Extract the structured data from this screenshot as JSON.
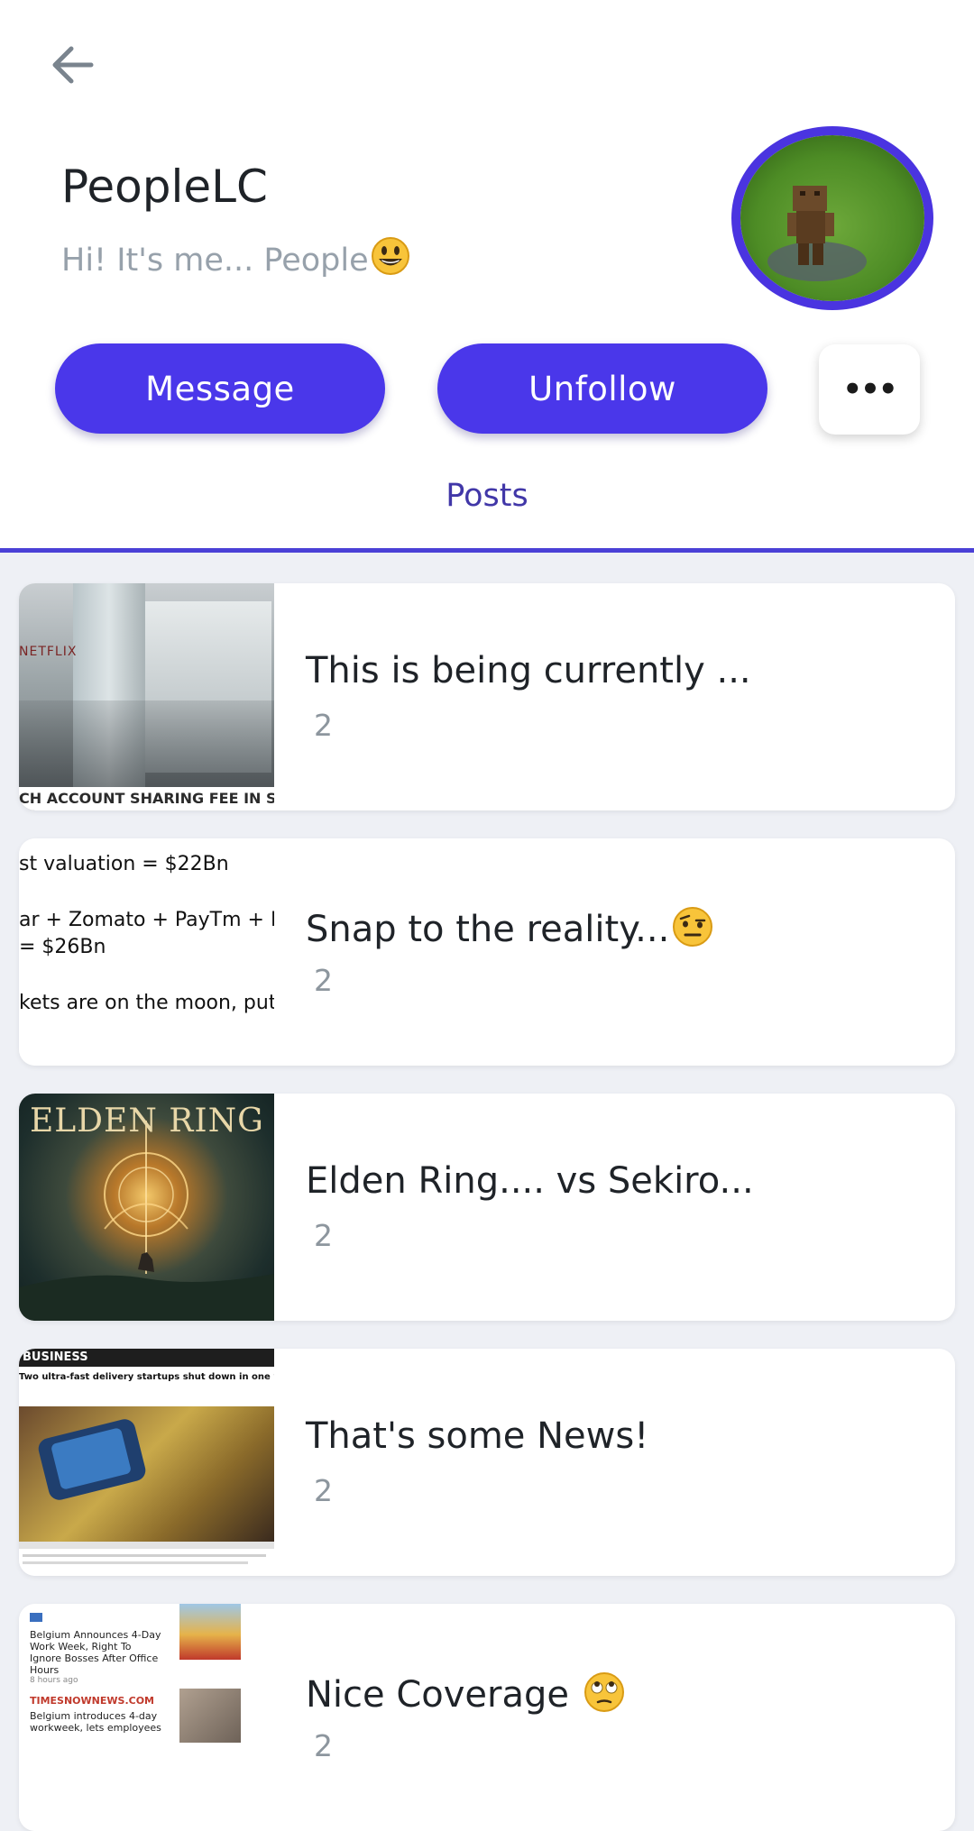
{
  "profile": {
    "name": "PeopleLC",
    "bio": "Hi! It's me... People"
  },
  "actions": {
    "message_label": "Message",
    "unfollow_label": "Unfollow",
    "more_label": "•••"
  },
  "tabs": {
    "posts_label": "Posts"
  },
  "colors": {
    "accent": "#4a37ea",
    "tab_text": "#4137a8",
    "card_bg": "#ffffff",
    "page_bg": "#eef0f5"
  },
  "posts": [
    {
      "title": "This is being currently ...",
      "count": "2",
      "thumb_text": [
        "NETFLIX",
        "CH ACCOUNT SHARING FEE IN SOME COU"
      ]
    },
    {
      "title": "Snap to the reality...",
      "count": "2",
      "thumb_text": [
        "st valuation = $22Bn",
        "ar + Zomato + PayTm + N",
        "= $26Bn",
        "kets are on the moon, put"
      ]
    },
    {
      "title": "Elden Ring.... vs Sekiro...",
      "count": "2",
      "thumb_text": [
        "ELDEN RING"
      ]
    },
    {
      "title": "That's some News!",
      "count": "2",
      "thumb_text": [
        "BUSINESS",
        "Two ultra-fast delivery startups shut down in one week"
      ]
    },
    {
      "title": "Nice Coverage",
      "count": "2",
      "thumb_text": [
        "Belgium Announces 4-Day Work Week, Right To Ignore Bosses After Office Hours",
        "8 hours ago",
        "TIMESNOWNEWS.COM",
        "Belgium introduces 4-day workweek, lets employees"
      ]
    }
  ]
}
